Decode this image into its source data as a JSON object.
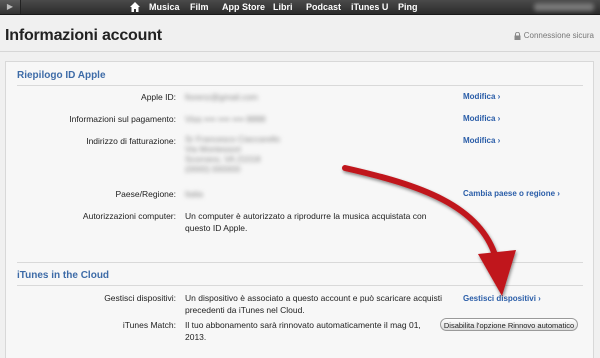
{
  "topbar": {
    "back_glyph": "▶",
    "items": [
      "Musica",
      "Film",
      "App Store",
      "Libri",
      "Podcast",
      "iTunes U",
      "Ping"
    ]
  },
  "header": {
    "title": "Informazioni account",
    "secure_label": "Connessione sicura"
  },
  "apple_id_section": {
    "title": "Riepilogo ID Apple",
    "rows": [
      {
        "label": "Apple ID:",
        "value": "fiorenz@gmail.com",
        "action": "Modifica ›"
      },
      {
        "label": "Informazioni sul pagamento:",
        "value": "Visa •••• •••• •••• 8888",
        "action": "Modifica ›"
      },
      {
        "label": "Indirizzo di fatturazione:",
        "value_lines": [
          "Sr Francesco Ciaccarello",
          "Via Montessori",
          "Scorrano, VA 21018",
          "(0000) 000000"
        ],
        "action": "Modifica ›"
      },
      {
        "label": "Paese/Regione:",
        "value": "Italia",
        "action": "Cambia paese o regione ›"
      },
      {
        "label": "Autorizzazioni computer:",
        "value_lines": [
          "Un computer è autorizzato a riprodurre la musica acquistata con",
          "questo ID Apple."
        ]
      }
    ]
  },
  "cloud_section": {
    "title": "iTunes in the Cloud",
    "rows": [
      {
        "label": "Gestisci dispositivi:",
        "value_lines": [
          "Un dispositivo è associato a questo account e può scaricare acquisti",
          "precedenti da iTunes nel Cloud."
        ],
        "action": "Gestisci dispositivi ›"
      },
      {
        "label": "iTunes Match:",
        "value_lines": [
          "Il tuo abbonamento sarà rinnovato automaticamente il mag 01,",
          "2013."
        ],
        "button": "Disabilita l'opzione Rinnovo automatico"
      }
    ]
  },
  "colors": {
    "accent": "#3d6ba7",
    "link": "#2a5da8",
    "annotation_arrow": "#c0141b"
  }
}
